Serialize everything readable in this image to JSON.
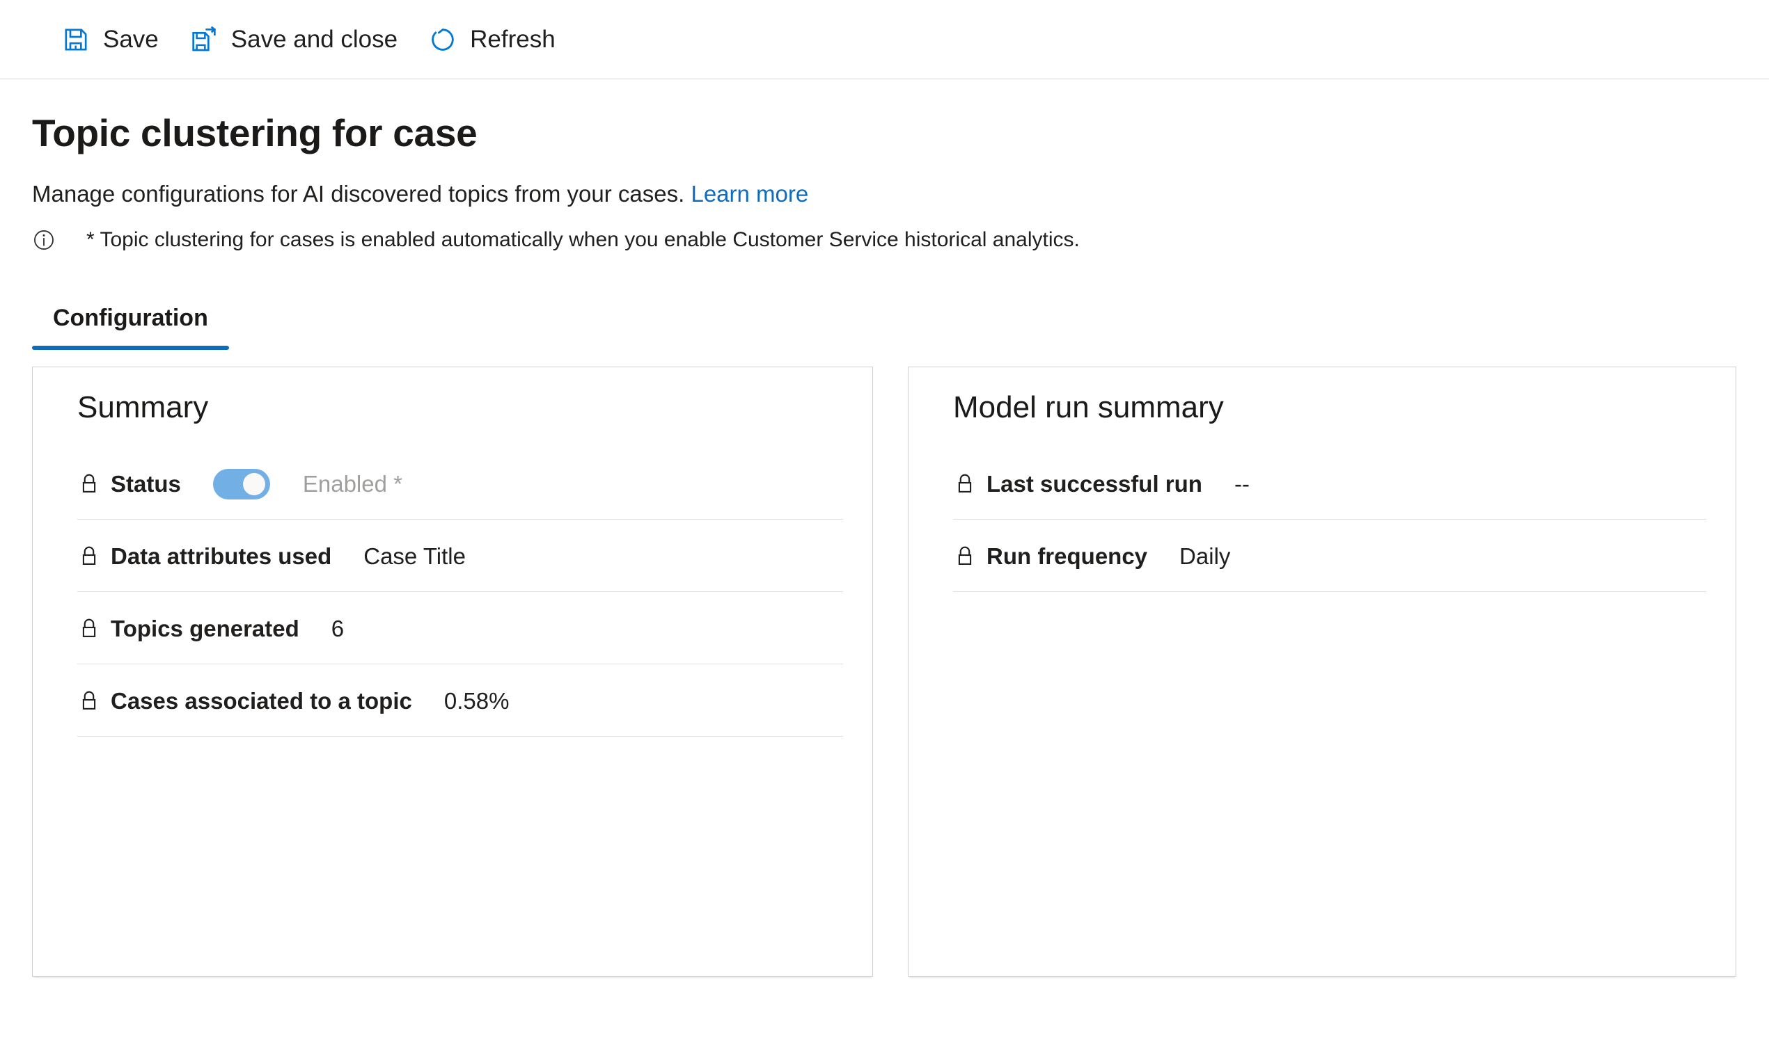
{
  "colors": {
    "accent": "#0f6cbd",
    "icon_blue": "#0078d4",
    "toggle_on_disabled": "#71afe5",
    "card_border": "#cfcfcf",
    "divider": "#e1dfdd",
    "muted_text": "#a19f9d"
  },
  "command_bar": {
    "buttons": [
      {
        "label": "Save",
        "icon": "save-icon"
      },
      {
        "label": "Save and close",
        "icon": "save-and-close-icon"
      },
      {
        "label": "Refresh",
        "icon": "refresh-icon"
      }
    ]
  },
  "header": {
    "title": "Topic clustering for case",
    "subtitle": "Manage configurations for AI discovered topics from your cases.",
    "learn_more": "Learn more",
    "note_icon": "info-icon",
    "note": "* Topic clustering for cases is enabled automatically when you enable Customer Service historical analytics."
  },
  "tabs": [
    {
      "label": "Configuration",
      "active": true
    }
  ],
  "summary_card": {
    "title": "Summary",
    "fields": [
      {
        "icon": "lock-icon",
        "label": "Status",
        "value": "Enabled *",
        "control": "toggle",
        "toggle_on": true
      },
      {
        "icon": "lock-icon",
        "label": "Data attributes used",
        "value": "Case Title"
      },
      {
        "icon": "lock-icon",
        "label": "Topics generated",
        "value": "6"
      },
      {
        "icon": "lock-icon",
        "label": "Cases associated to a topic",
        "value": "0.58%"
      }
    ]
  },
  "model_run_card": {
    "title": "Model run summary",
    "fields": [
      {
        "icon": "lock-icon",
        "label": "Last successful run",
        "value": "--"
      },
      {
        "icon": "lock-icon",
        "label": "Run frequency",
        "value": "Daily"
      }
    ]
  }
}
